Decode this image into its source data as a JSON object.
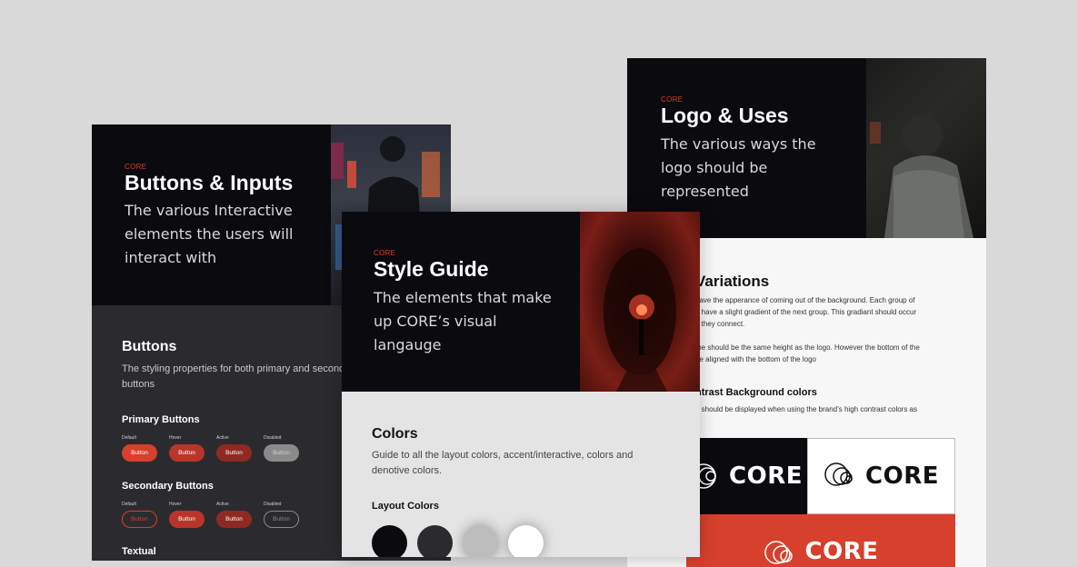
{
  "buttons_card": {
    "eyebrow": "CORE",
    "title": "Buttons & Inputs",
    "subtitle_lines": [
      "The various Interactive",
      "elements the users will",
      "interact with"
    ],
    "section_title": "Buttons",
    "section_desc_lines": [
      "The styling properties for both primary and secondary",
      "buttons"
    ],
    "primary_title": "Primary Buttons",
    "secondary_title": "Secondary Buttons",
    "next_title": "Textual",
    "states": [
      "Default",
      "Hover",
      "Active",
      "Disabled"
    ],
    "button_label": "Button"
  },
  "style_card": {
    "eyebrow": "CORE",
    "title": "Style Guide",
    "subtitle_lines": [
      "The elements that make",
      "up CORE’s visual",
      "langauge"
    ],
    "section_title": "Colors",
    "section_desc_lines": [
      "Guide to all the layout colors, accent/interactive, colors and",
      "denotive colors."
    ],
    "layout_colors_title": "Layout Colors",
    "swatches": [
      "#0a0a0f",
      "#2b2b2f",
      "#bdbdbd",
      "#ffffff"
    ]
  },
  "logo_card": {
    "eyebrow": "CORE",
    "title": "Logo & Uses",
    "subtitle_lines": [
      "The various ways the",
      "logo should be",
      "represented"
    ],
    "variations_title": "Variations",
    "variations_text": [
      "have the apperance of coming out of the background. Each group of",
      "d have a slight gradient of the next group. This gradiant should occur",
      "e they connect."
    ],
    "size_text": [
      "me should be the same height as the logo. However the bottom of the",
      "be aligned with the bottom of the logo"
    ],
    "contrast_title": "ntrast Background colors",
    "contrast_text": [
      "o should be displayed when using the brand’s high contrast colors as",
      "s"
    ],
    "logo_word": "CORE"
  },
  "colors": {
    "accent": "#d6402c",
    "dark": "#0a0a0f",
    "panel": "#2b2b2f"
  }
}
